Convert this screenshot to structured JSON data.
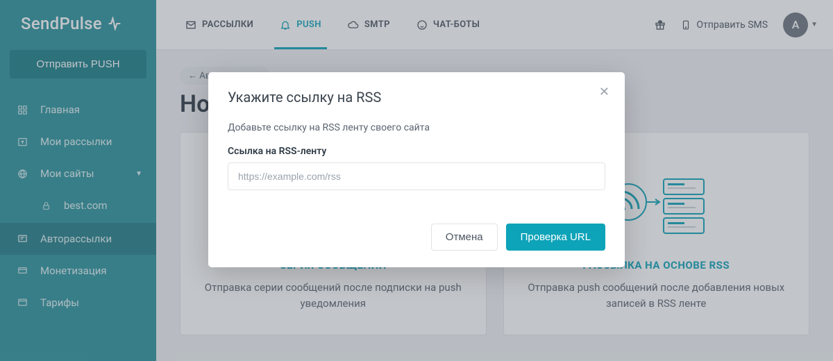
{
  "brand": "SendPulse",
  "sidebar": {
    "primary_button": "Отправить PUSH",
    "items": [
      {
        "label": "Главная"
      },
      {
        "label": "Мои рассылки"
      },
      {
        "label": "Мои сайты",
        "expandable": true
      },
      {
        "label": "best.com",
        "sub": true
      },
      {
        "label": "Авторассылки",
        "active": true
      },
      {
        "label": "Монетизация"
      },
      {
        "label": "Тарифы"
      }
    ]
  },
  "tabs": [
    {
      "label": "РАССЫЛКИ"
    },
    {
      "label": "PUSH",
      "active": true
    },
    {
      "label": "SMTP"
    },
    {
      "label": "ЧАТ-БОТЫ"
    }
  ],
  "topbar": {
    "sms_label": "Отправить SMS",
    "avatar_letter": "А"
  },
  "page": {
    "back_label": "← Авторассылки",
    "title": "Новая авторассылка",
    "card_series_title": "СЕРИЯ СООБЩЕНИЙ",
    "card_series_desc": "Отправка серии сообщений после подписки на push уведомления",
    "card_rss_title": "РАССЫЛКА НА ОСНОВЕ RSS",
    "card_rss_desc": "Отправка push сообщений после добавления новых записей в RSS ленте"
  },
  "modal": {
    "title": "Укажите ссылку на RSS",
    "lead": "Добавьте ссылку на RSS ленту своего сайта",
    "field_label": "Ссылка на RSS-ленту",
    "placeholder": "https://example.com/rss",
    "cancel": "Отмена",
    "submit": "Проверка URL"
  }
}
